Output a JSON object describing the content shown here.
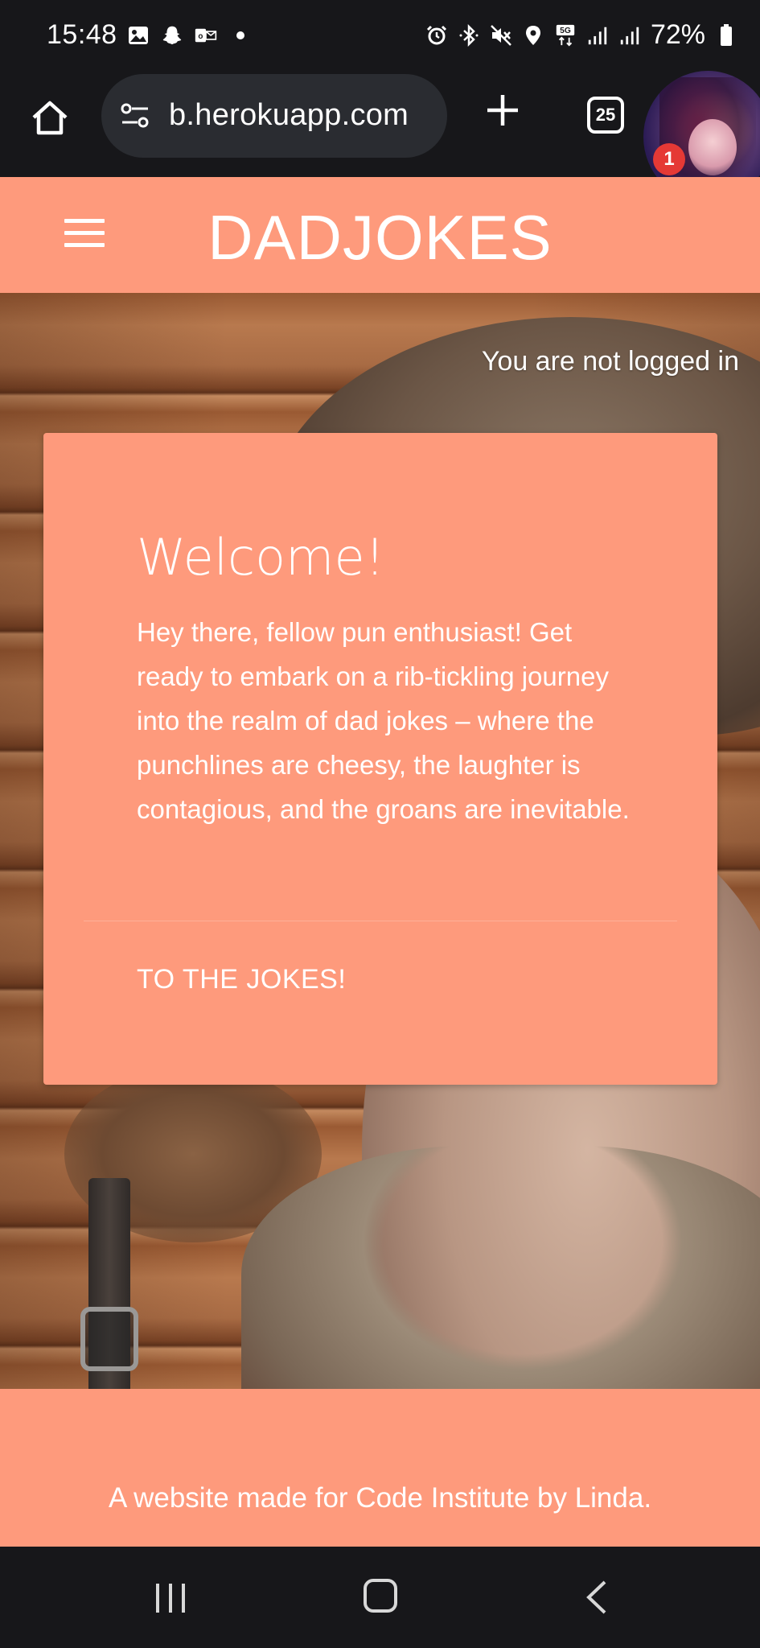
{
  "status_bar": {
    "time": "15:48",
    "battery": "72%",
    "left_icons": [
      "image-icon",
      "snapchat-icon",
      "outlook-icon",
      "dot-icon"
    ],
    "right_icons": [
      "alarm-icon",
      "bluetooth-icon",
      "mute-icon",
      "location-icon",
      "5g-icon",
      "signal-icon",
      "signal-icon",
      "battery-icon"
    ]
  },
  "browser": {
    "url": "b.herokuapp.com",
    "tab_count": "25",
    "notification_count": "1"
  },
  "header": {
    "brand": "DADJOKES"
  },
  "hero": {
    "login_status": "You are not logged in"
  },
  "card": {
    "title": "Welcome!",
    "text": "Hey there, fellow pun enthusiast! Get ready to embark on a rib-tickling journey into the realm of dad jokes – where the punchlines are cheesy, the laughter is contagious, and the groans are inevitable.",
    "action": "TO THE JOKES!"
  },
  "footer": {
    "text": "A website made for Code Institute by Linda."
  },
  "colors": {
    "accent": "#fe9a7c",
    "system_bar": "#17171a",
    "text_on_accent": "#ffffff"
  }
}
